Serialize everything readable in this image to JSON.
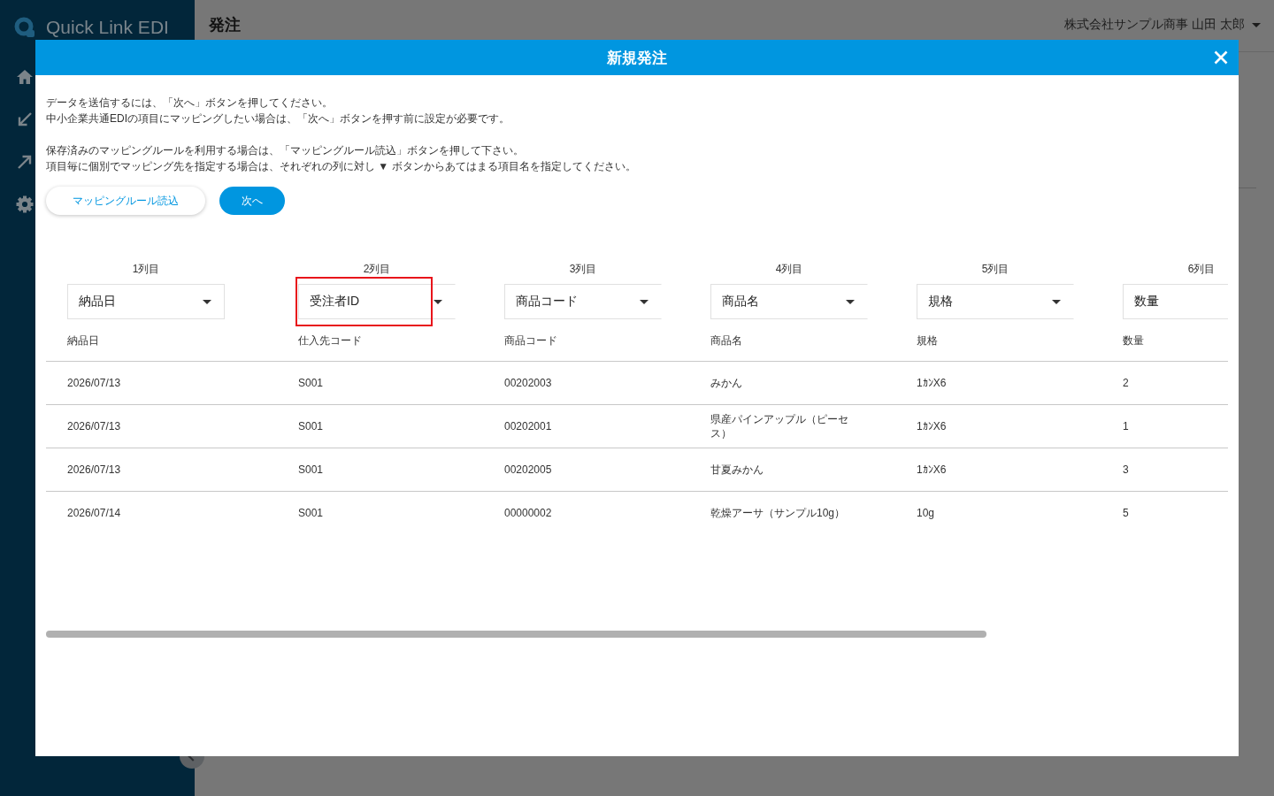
{
  "app": {
    "logo": "Quick Link EDI",
    "page_title": "発注",
    "user": "株式会社サンプル商事 山田 太郎"
  },
  "dialog": {
    "title": "新規発注",
    "instructions": [
      {
        "lines": [
          "データを送信するには、「次へ」ボタンを押してください。",
          "中小企業共通EDIの項目にマッピングしたい場合は、「次へ」ボタンを押す前に設定が必要です。"
        ]
      },
      {
        "lines": [
          "保存済みのマッピングルールを利用する場合は、「マッピングルール読込」ボタンを押して下さい。",
          "項目毎に個別でマッピング先を指定する場合は、それぞれの列に対し ▼ ボタンからあてはまる項目名を指定してください。"
        ]
      }
    ],
    "buttons": [
      {
        "label": "マッピングルール読込",
        "kind": "secondary"
      },
      {
        "label": "次へ",
        "kind": "primary"
      }
    ],
    "columns": [
      {
        "heading": "1列目",
        "mapping": "納品日",
        "source": "納品日",
        "highlighted": false
      },
      {
        "heading": "2列目",
        "mapping": "受注者ID",
        "source": "仕入先コード",
        "highlighted": true
      },
      {
        "heading": "3列目",
        "mapping": "商品コード",
        "source": "商品コード",
        "highlighted": false
      },
      {
        "heading": "4列目",
        "mapping": "商品名",
        "source": "商品名",
        "highlighted": false
      },
      {
        "heading": "5列目",
        "mapping": "規格",
        "source": "規格",
        "highlighted": false
      },
      {
        "heading": "6列目",
        "mapping": "数量",
        "source": "数量",
        "highlighted": false
      }
    ],
    "rows": [
      [
        "2026/07/13",
        "S001",
        "00202003",
        "みかん",
        "1ｶﾝX6",
        "2"
      ],
      [
        "2026/07/13",
        "S001",
        "00202001",
        "県産パインアップル（ピーセス）",
        "1ｶﾝX6",
        "1"
      ],
      [
        "2026/07/13",
        "S001",
        "00202005",
        "甘夏みかん",
        "1ｶﾝX6",
        "3"
      ],
      [
        "2026/07/14",
        "S001",
        "00000002",
        "乾燥アーサ（サンプル10g）",
        "10g",
        "5"
      ]
    ]
  }
}
